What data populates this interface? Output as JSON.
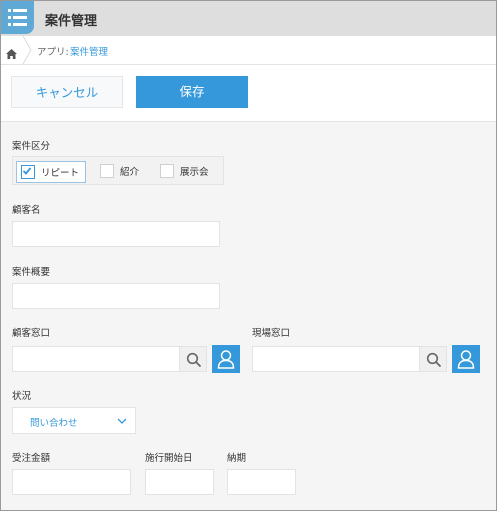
{
  "header": {
    "app_icon": "list-icon",
    "title": "案件管理"
  },
  "breadcrumb": {
    "home_icon": "home-icon",
    "prefix": "アプリ:",
    "current": "案件管理"
  },
  "actions": {
    "cancel_label": "キャンセル",
    "save_label": "保存"
  },
  "form": {
    "category": {
      "label": "案件区分",
      "options": [
        {
          "label": "リピート",
          "checked": true
        },
        {
          "label": "紹介",
          "checked": false
        },
        {
          "label": "展示会",
          "checked": false
        }
      ]
    },
    "customer_name": {
      "label": "顧客名",
      "value": ""
    },
    "summary": {
      "label": "案件概要",
      "value": ""
    },
    "customer_contact": {
      "label": "顧客窓口",
      "value": "",
      "search_icon": "search-icon",
      "user_icon": "user-icon"
    },
    "site_contact": {
      "label": "現場窓口",
      "value": "",
      "search_icon": "search-icon",
      "user_icon": "user-icon"
    },
    "status": {
      "label": "状況",
      "selected": "問い合わせ"
    },
    "order_amount": {
      "label": "受注金額",
      "value": ""
    },
    "start_date": {
      "label": "施行開始日",
      "value": ""
    },
    "deadline": {
      "label": "納期",
      "value": ""
    }
  },
  "colors": {
    "accent": "#3498db",
    "header_bg": "#dedede",
    "app_icon_bg": "#5ea9d6"
  }
}
